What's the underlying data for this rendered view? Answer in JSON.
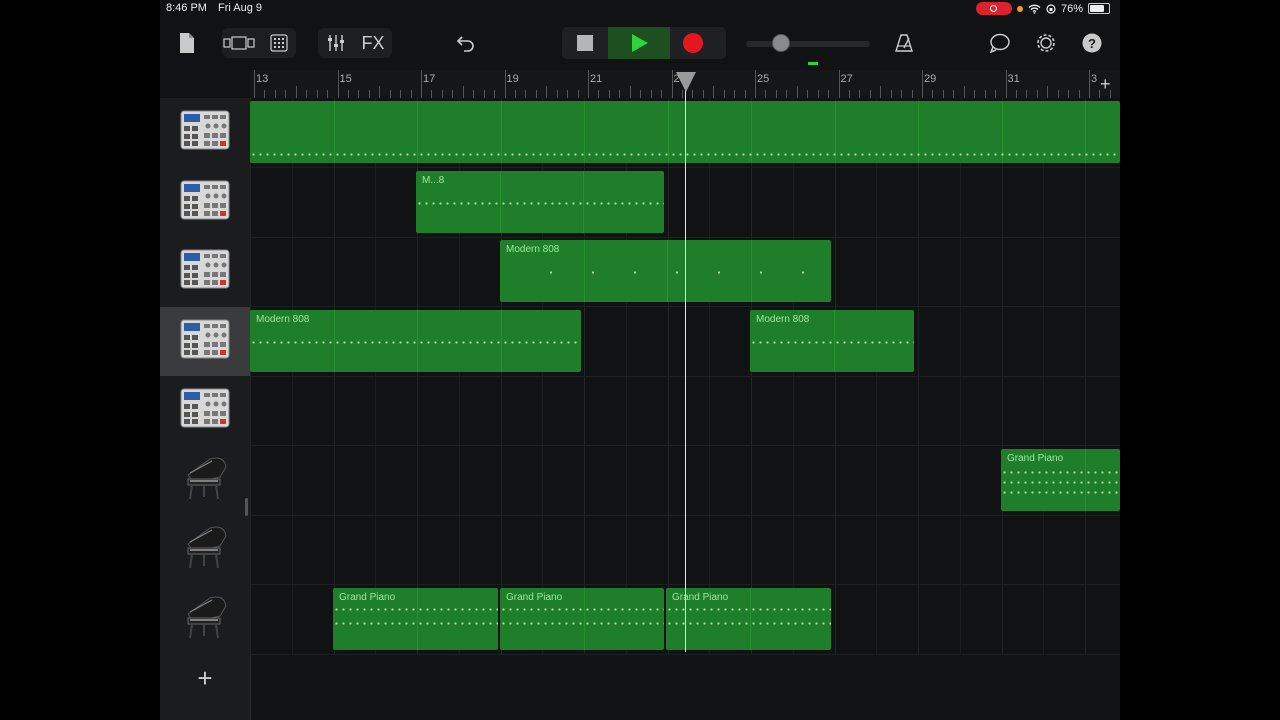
{
  "status": {
    "time": "8:46 PM",
    "date": "Fri Aug 9",
    "battery": "76%",
    "battery_level": 0.76
  },
  "colors": {
    "region": "#1f7e2a",
    "record": "#e3171f",
    "play": "#2fd33a",
    "playhead": "#e6e6e6"
  },
  "toolbar": {
    "fx_label": "FX",
    "icons": [
      "document-icon",
      "view-toggle-icon",
      "grid-icon",
      "mixer-icon",
      "undo-icon",
      "stop-icon",
      "play-icon",
      "record-icon",
      "metronome-icon",
      "loop-icon",
      "settings-icon",
      "help-icon"
    ]
  },
  "ruler": {
    "bars": [
      "13",
      "15",
      "17",
      "19",
      "21",
      "23",
      "25",
      "27",
      "29",
      "31",
      "3"
    ],
    "add_label": "+"
  },
  "tracks": [
    {
      "instrument": "drum-machine-icon",
      "selected": false,
      "regions": []
    },
    {
      "instrument": "drum-machine-icon",
      "selected": false,
      "regions": [
        {
          "label": "M...8"
        }
      ]
    },
    {
      "instrument": "drum-machine-icon",
      "selected": false,
      "regions": [
        {
          "label": "Modern 808"
        }
      ]
    },
    {
      "instrument": "drum-machine-icon",
      "selected": true,
      "regions": [
        {
          "label": "Modern 808"
        },
        {
          "label": "Modern 808"
        }
      ]
    },
    {
      "instrument": "drum-machine-icon",
      "selected": false,
      "regions": []
    },
    {
      "instrument": "grand-piano-icon",
      "selected": false,
      "regions": [
        {
          "label": "Grand Piano"
        }
      ]
    },
    {
      "instrument": "grand-piano-icon",
      "selected": false,
      "regions": []
    },
    {
      "instrument": "grand-piano-icon",
      "selected": false,
      "regions": [
        {
          "label": "Grand Piano"
        },
        {
          "label": "Grand Piano"
        },
        {
          "label": "Grand Piano"
        }
      ]
    }
  ],
  "add_track_label": "+"
}
